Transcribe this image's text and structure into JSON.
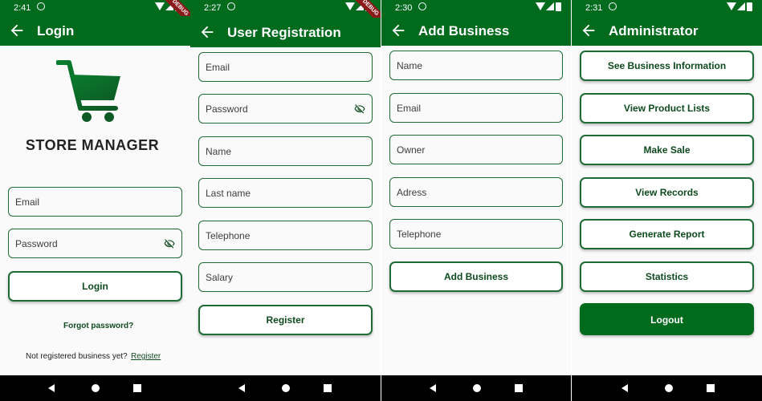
{
  "colors": {
    "primary": "#006a1d",
    "border": "#1e6b34",
    "text_green": "#0e4b1e"
  },
  "debug_label": "DEBUG",
  "screens": [
    {
      "time": "2:41",
      "title": "Login",
      "logo_text": "STORE MANAGER",
      "fields": [
        {
          "label": "Email"
        },
        {
          "label": "Password"
        }
      ],
      "login_button": "Login",
      "forgot_password": "Forgot password?",
      "not_registered": "Not registered business yet?",
      "register_link": "Register"
    },
    {
      "time": "2:27",
      "title": "User Registration",
      "fields": [
        {
          "label": "Email"
        },
        {
          "label": "Password"
        },
        {
          "label": "Name"
        },
        {
          "label": "Last name"
        },
        {
          "label": "Telephone"
        },
        {
          "label": "Salary"
        }
      ],
      "register_button": "Register"
    },
    {
      "time": "2:30",
      "title": "Add Business",
      "fields": [
        {
          "label": "Name"
        },
        {
          "label": "Email"
        },
        {
          "label": "Owner"
        },
        {
          "label": "Adress"
        },
        {
          "label": "Telephone"
        }
      ],
      "add_button": "Add Business"
    },
    {
      "time": "2:31",
      "title": "Administrator",
      "buttons": [
        {
          "label": "See Business Information"
        },
        {
          "label": "View Product Lists"
        },
        {
          "label": "Make Sale"
        },
        {
          "label": "View Records"
        },
        {
          "label": "Generate Report"
        },
        {
          "label": "Statistics"
        }
      ],
      "logout_button": "Logout"
    }
  ]
}
